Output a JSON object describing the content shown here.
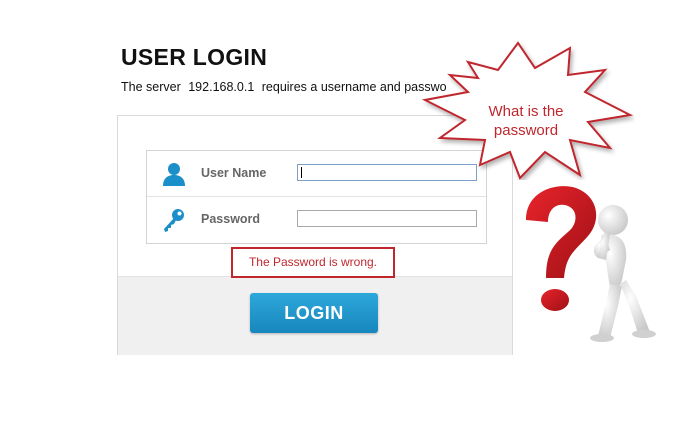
{
  "page": {
    "title": "USER LOGIN",
    "subtitle_prefix": "The server",
    "server_ip": "192.168.0.1",
    "subtitle_suffix": "requires a username and passwo"
  },
  "form": {
    "username_label": "User Name",
    "username_value": "",
    "password_label": "Password",
    "password_value": ""
  },
  "error_message": "The Password is wrong.",
  "login_button_label": "LOGIN",
  "callout": {
    "line1": "What is the",
    "line2": "password"
  },
  "colors": {
    "accent_blue": "#1f97cf",
    "error_red": "#c0272d",
    "icon_blue": "#1a8fc9"
  },
  "icons": [
    "user-icon",
    "key-icon",
    "question-mark-figure"
  ]
}
